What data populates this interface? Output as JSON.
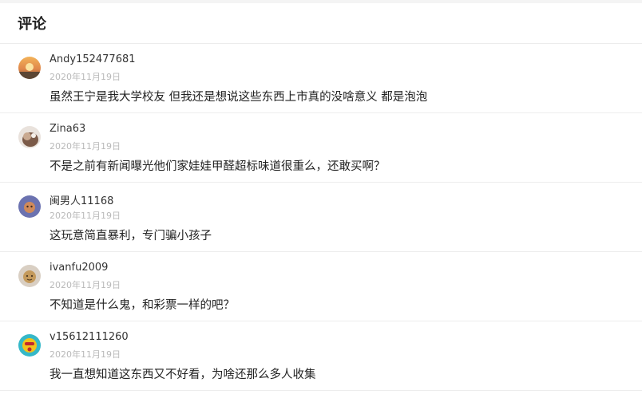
{
  "header": {
    "title": "评论"
  },
  "comments": [
    {
      "user": "Andy152477681",
      "date": "2020年11月19日",
      "text": "虽然王宁是我大学校友 但我还是想说这些东西上市真的没啥意义 都是泡泡"
    },
    {
      "user": "Zina63",
      "date": "2020年11月19日",
      "text": "不是之前有新闻曝光他们家娃娃甲醛超标味道很重么，还敢买啊？"
    },
    {
      "user": "闽男人11168",
      "date": "2020年11月19日",
      "text": "这玩意简直暴利，专门骗小孩子"
    },
    {
      "user": "ivanfu2009",
      "date": "2020年11月19日",
      "text": "不知道是什么鬼，和彩票一样的吧？"
    },
    {
      "user": "v15612111260",
      "date": "2020年11月19日",
      "text": "我一直想知道这东西又不好看，为啥还那么多人收集"
    }
  ]
}
